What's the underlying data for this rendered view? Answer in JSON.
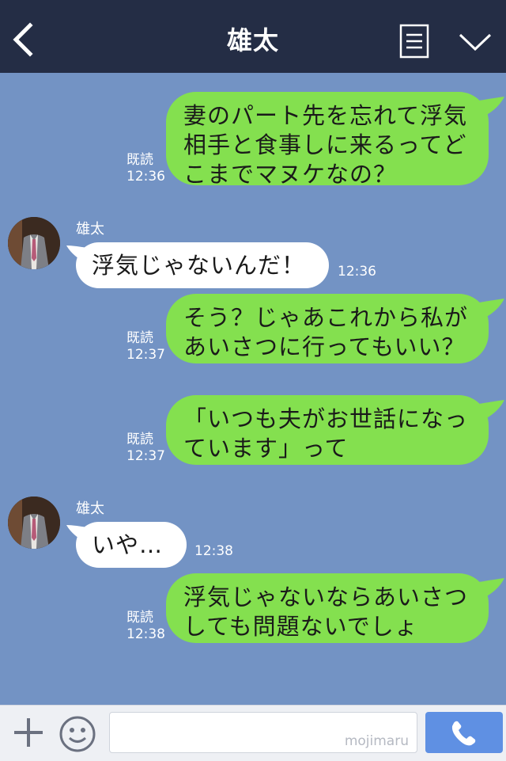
{
  "header": {
    "title": "雄太"
  },
  "contact": {
    "name": "雄太"
  },
  "messages": [
    {
      "type": "out",
      "lines": [
        "妻のパート先を忘れて浮気",
        "相手と食事しに来るってど",
        "こまでマヌケなの？"
      ],
      "read": "既読",
      "time": "12:36"
    },
    {
      "type": "in",
      "sender": "雄太",
      "text": "浮気じゃないんだ！",
      "time": "12:36"
    },
    {
      "type": "out",
      "lines": [
        "そう？じゃあこれから私が",
        "あいさつに行ってもいい？"
      ],
      "read": "既読",
      "time": "12:37"
    },
    {
      "type": "out",
      "lines": [
        "「いつも夫がお世話になっ",
        "ています」って"
      ],
      "read": "既読",
      "time": "12:37"
    },
    {
      "type": "in",
      "sender": "雄太",
      "text": "いや…",
      "time": "12:38"
    },
    {
      "type": "out",
      "lines": [
        "浮気じゃないならあいさつ",
        "しても問題ないでしょ"
      ],
      "read": "既読",
      "time": "12:38"
    }
  ],
  "input": {
    "value": "",
    "watermark": "mojimaru"
  },
  "icons": {
    "back": "chevron-left-icon",
    "menu": "list-icon",
    "collapse": "chevron-down-icon",
    "plus": "plus-icon",
    "emoji": "smiley-icon",
    "call": "phone-icon"
  },
  "colors": {
    "header": "#242d45",
    "background": "#7393c4",
    "outgoing": "#84e04f",
    "incoming": "#ffffff",
    "call_button": "#5f90e3"
  }
}
